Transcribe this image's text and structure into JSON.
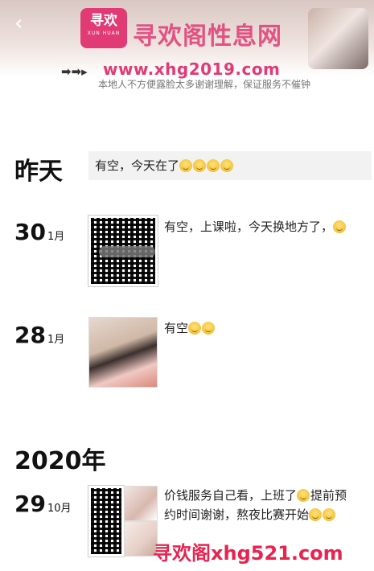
{
  "header": {
    "back_icon": "chevron-left-icon",
    "logo_cn": "寻欢",
    "logo_en": "XUN HUAN",
    "watermark_title": "寻欢阁性息网",
    "watermark_arrow": "➡➡▸",
    "watermark_url": "www.xhg2019.com",
    "notice": "本地人不方便露脸太多谢谢理解，保证服务不催钟"
  },
  "posts": [
    {
      "day": "昨天",
      "month": "",
      "text": "有空，今天在了",
      "emoji_count": 4
    },
    {
      "day": "30",
      "month": "1月",
      "text": "有空，上课啦，今天换地方了，",
      "emoji_count": 1
    },
    {
      "day": "28",
      "month": "1月",
      "text": "有空",
      "emoji_count": 2
    },
    {
      "day": "29",
      "month": "10月",
      "text_line1": "价钱服务自己看，上班了",
      "text_line1b": "提前预",
      "text_line2": "约时间谢谢，熬夜比赛开始",
      "emoji_count": 3
    }
  ],
  "year_label": "2020年",
  "bottom_watermark": "寻欢阁xhg521.com",
  "colors": {
    "brand": "#e13a74",
    "watermark_red": "#e8234f",
    "bubble": "#f2f2f2"
  }
}
